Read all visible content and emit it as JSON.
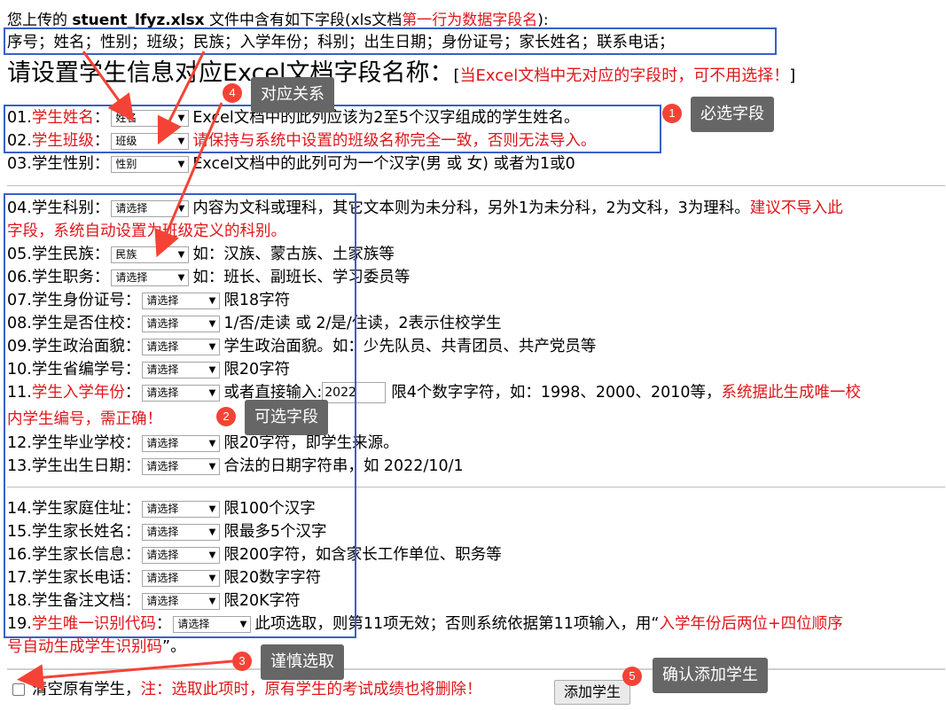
{
  "header": {
    "line1_prefix": "您上传的",
    "filename": "stuent_lfyz.xlsx",
    "line1_mid": "文件中含有如下字段(xls文档",
    "line1_red": "第一行为数据字段名",
    "line1_suffix": "):",
    "fields_list": "序号；姓名；性别；班级；民族；入学年份；科别；出生日期；身份证号；家长姓名；联系电话；",
    "title": "请设置学生信息对应Excel文档字段名称：",
    "title_note_open": "[",
    "title_note_red": "当Excel文档中无对应的字段时，可不用选择！",
    "title_note_close": "]"
  },
  "rows": [
    {
      "num": "01.",
      "label": "学生姓名",
      "label_red": true,
      "colon": "：",
      "select": "姓名",
      "desc": "Excel文档中的此列应该为2至5个汉字组成的学生姓名。",
      "desc_red": ""
    },
    {
      "num": "02.",
      "label": "学生班级",
      "label_red": true,
      "colon": "：",
      "select": "班级",
      "desc": "",
      "desc_red": "请保持与系统中设置的班级名称完全一致，否则无法导入。"
    },
    {
      "num": "03.",
      "label": "学生性别",
      "colon": "：",
      "select": "性别",
      "desc": "Excel文档中的此列可为一个汉字(男 或 女) 或者为1或0"
    },
    {
      "num": "04.",
      "label": "学生科别",
      "colon": "：",
      "select": "请选择",
      "desc": "内容为文科或理科，其它文本则为未分科，另外1为未分科，2为文科，3为理科。",
      "desc_red": "建议不导入此",
      "desc_red2": "字段，系统自动设置为班级定义的科别。"
    },
    {
      "num": "05.",
      "label": "学生民族",
      "colon": "：",
      "select": "民族",
      "desc": "如：汉族、蒙古族、土家族等"
    },
    {
      "num": "06.",
      "label": "学生职务",
      "colon": "：",
      "select": "请选择",
      "desc": "如：班长、副班长、学习委员等"
    },
    {
      "num": "07.",
      "label": "学生身份证号",
      "colon": "：",
      "select": "请选择",
      "desc": "限18字符"
    },
    {
      "num": "08.",
      "label": "学生是否住校",
      "colon": "：",
      "select": "请选择",
      "desc": "1/否/走读 或 2/是/住读，2表示住校学生"
    },
    {
      "num": "09.",
      "label": "学生政治面貌",
      "colon": "：",
      "select": "请选择",
      "desc": "学生政治面貌。如：少先队员、共青团员、共产党员等"
    },
    {
      "num": "10.",
      "label": "学生省编学号",
      "colon": "：",
      "select": "请选择",
      "desc": "限20字符"
    },
    {
      "num": "11.",
      "label": "学生入学年份",
      "label_red": true,
      "colon": "：",
      "select": "请选择",
      "desc_pre": "或者直接输入:",
      "input_value": "2022",
      "desc": "限4个数字字符，如：1998、2000、2010等，",
      "desc_red": "系统据此生成唯一校",
      "desc_red2": "内学生编号，需正确！"
    },
    {
      "num": "12.",
      "label": "学生毕业学校",
      "colon": "：",
      "select": "请选择",
      "desc": "限20字符，即学生来源。"
    },
    {
      "num": "13.",
      "label": "学生出生日期",
      "colon": "：",
      "select": "请选择",
      "desc": "合法的日期字符串，如 2022/10/1"
    },
    {
      "num": "14.",
      "label": "学生家庭住址",
      "colon": "：",
      "select": "请选择",
      "desc": "限100个汉字"
    },
    {
      "num": "15.",
      "label": "学生家长姓名",
      "colon": "：",
      "select": "请选择",
      "desc": "限最多5个汉字"
    },
    {
      "num": "16.",
      "label": "学生家长信息",
      "colon": "：",
      "select": "请选择",
      "desc": "限200字符，如含家长工作单位、职务等"
    },
    {
      "num": "17.",
      "label": "学生家长电话",
      "colon": "：",
      "select": "请选择",
      "desc": "限20数字字符"
    },
    {
      "num": "18.",
      "label": "学生备注文档",
      "colon": "：",
      "select": "请选择",
      "desc": "限20K字符"
    },
    {
      "num": "19.",
      "label": "学生唯一识别代码",
      "label_red": true,
      "colon": "：",
      "select": "请选择",
      "desc": "此项选取，则第11项无效；否则系统依据第11项输入，用“",
      "desc_red": "入学年份后两位+四位顺序",
      "desc_red2": "号自动生成学生识别码",
      "desc_end": "”。"
    }
  ],
  "footer": {
    "checkbox_label": "清空原有学生，",
    "warning": "注：选取此项时，原有学生的考试成绩也将删除！",
    "button": "添加学生"
  },
  "callouts": [
    {
      "num": "1",
      "text": "必选字段"
    },
    {
      "num": "2",
      "text": "可选字段"
    },
    {
      "num": "3",
      "text": "谨慎选取"
    },
    {
      "num": "4",
      "text": "对应关系"
    },
    {
      "num": "5",
      "text": "确认添加学生"
    }
  ],
  "colors": {
    "red": "#e0161b",
    "box_blue": "#3a5fc8",
    "badge": "#f44336",
    "callout_bg": "#666666"
  }
}
